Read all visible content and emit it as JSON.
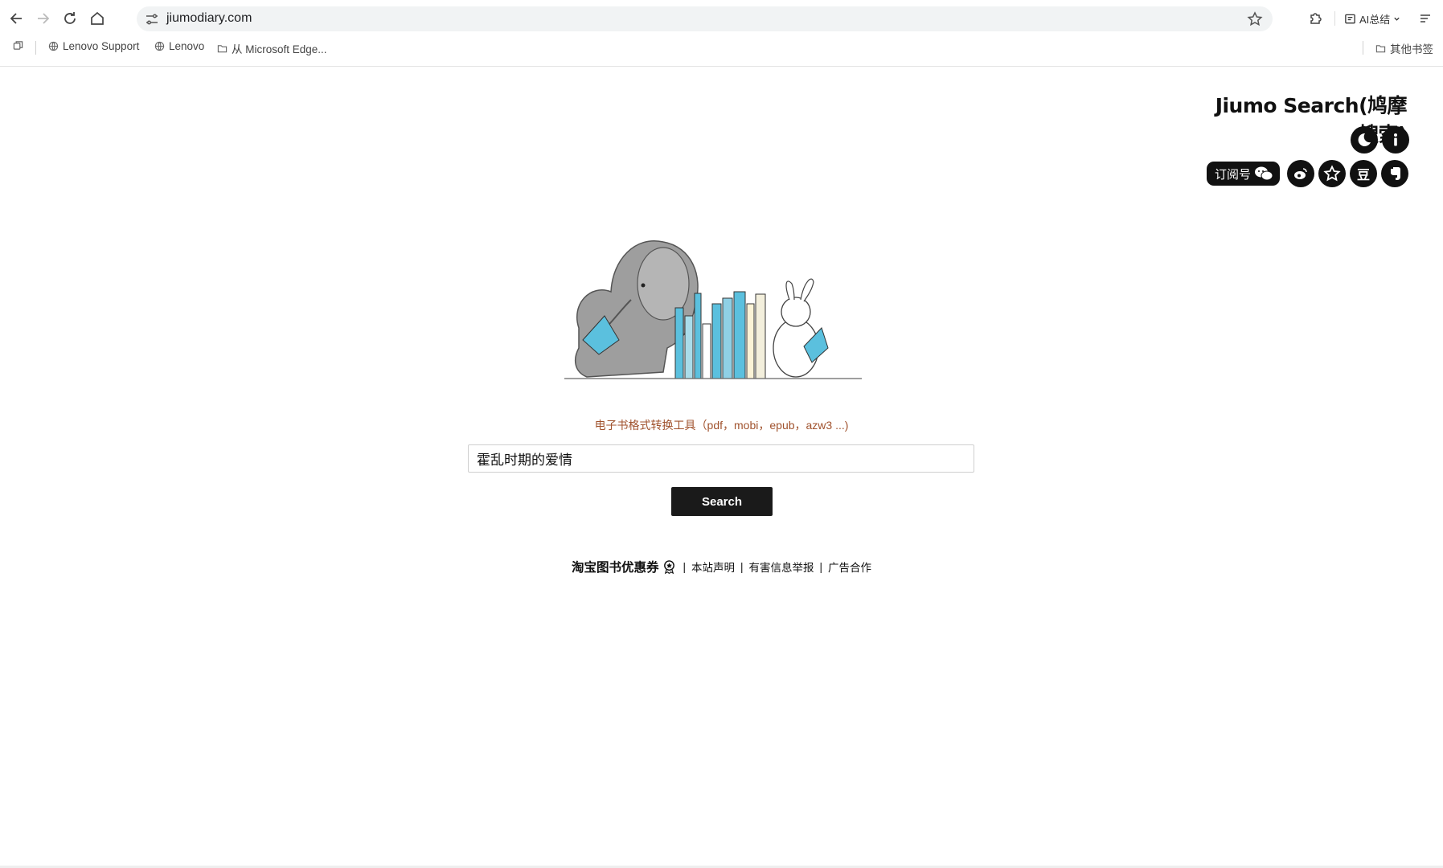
{
  "browser": {
    "url": "jiumodiary.com",
    "ai_summary_label": "AI总结",
    "bookmarks": [
      {
        "label": "Lenovo Support"
      },
      {
        "label": "Lenovo"
      },
      {
        "label": "从 Microsoft Edge..."
      }
    ],
    "other_bookmarks_label": "其他书签"
  },
  "page": {
    "logo": "Jiumo Search(鸠摩搜索)",
    "wechat_pill_label": "订阅号",
    "social_icons": {
      "douban_glyph": "豆"
    },
    "converter_link": "电子书格式转换工具（pdf，mobi，epub，azw3 ...)",
    "search": {
      "value": "霍乱时期的爱情",
      "button_label": "Search"
    },
    "footer": {
      "taobao": "淘宝图书优惠券",
      "statement": "本站声明",
      "report": "有害信息举报",
      "ads": "广告合作",
      "separator": "|"
    }
  },
  "colors": {
    "link_brown": "#a0522d",
    "button_dark": "#1a1a1a",
    "book_blue": "#5bc0de"
  }
}
